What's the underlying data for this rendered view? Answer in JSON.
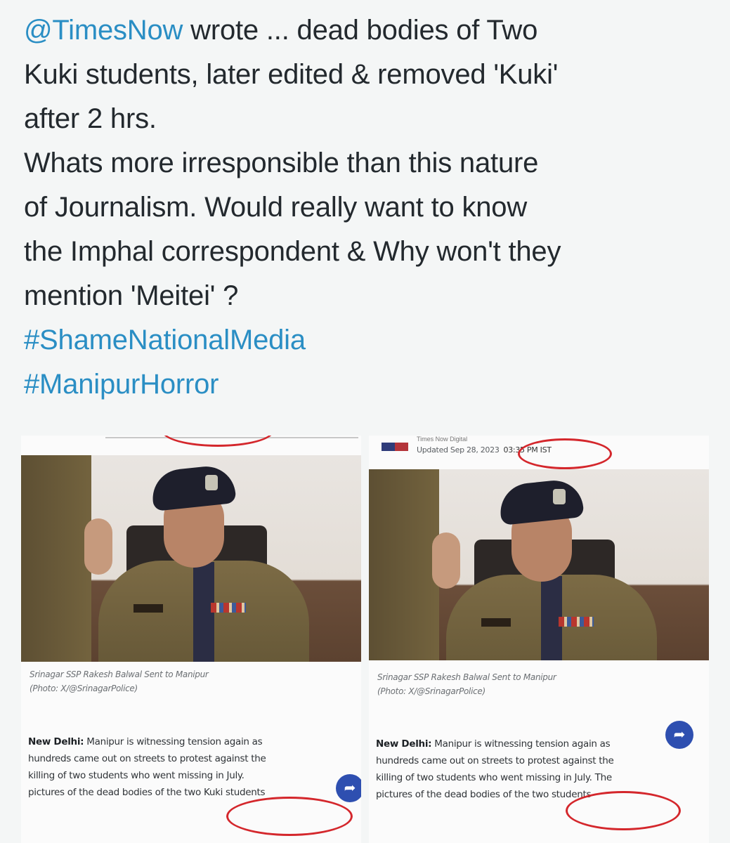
{
  "tweet": {
    "mention": "@TimesNow",
    "line1_rest": " wrote ... dead bodies of Two",
    "line2": "Kuki students, later edited & removed 'Kuki'",
    "line3": "after 2 hrs.",
    "line4": "Whats more irresponsible than this nature",
    "line5": "of Journalism. Would really want to know",
    "line6": "the Imphal correspondent & Why won't they",
    "line7": "mention 'Meitei' ?",
    "hashtags": [
      "#ShameNationalMedia",
      "#ManipurHorror"
    ]
  },
  "left_card": {
    "caption_line1": "Srinagar SSP Rakesh Balwal Sent to Manipur",
    "caption_line2": "(Photo: X/@SrinagarPolice)",
    "dateline": "New Delhi:",
    "article_lines": [
      " Manipur is witnessing tension again as",
      "hundreds came out on streets to protest against the",
      "killing of two students who went missing in July.",
      "pictures of the dead bodies of the two Kuki students"
    ]
  },
  "right_card": {
    "site_name": "Times Now Digital",
    "updated_label": "Updated Sep 28, 2023",
    "updated_time": "03:35 PM IST",
    "caption_line1": "Srinagar SSP Rakesh Balwal Sent to Manipur",
    "caption_line2": "(Photo: X/@SrinagarPolice)",
    "dateline": "New Delhi:",
    "article_lines": [
      " Manipur is witnessing tension again as",
      "hundreds came out on streets to protest against the",
      "killing of two students who went missing in July. The",
      "pictures of the dead bodies of the two students"
    ]
  },
  "icons": {
    "share": "share-icon"
  },
  "colors": {
    "link": "#2a8ec4",
    "annotation": "#d4272c",
    "share_button": "#2e4fb0"
  }
}
